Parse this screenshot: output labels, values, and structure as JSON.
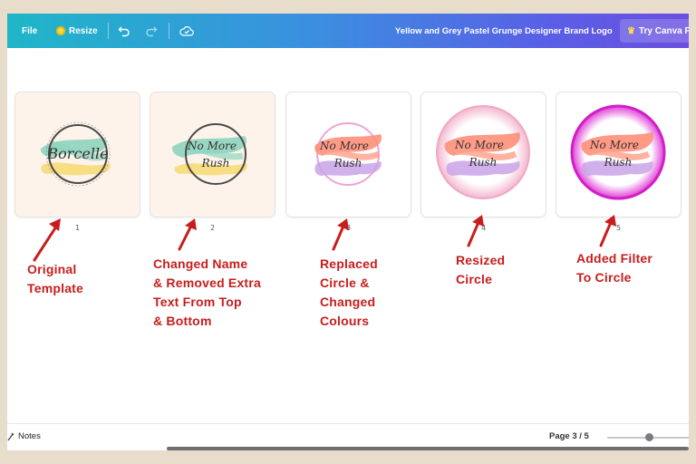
{
  "toolbar": {
    "file_label": "File",
    "resize_label": "Resize",
    "doc_title": "Yellow and Grey Pastel Grunge Designer Brand Logo",
    "try_label": "Try Canva Pr"
  },
  "pages": [
    {
      "number": "1",
      "caption": [
        "Original",
        "Template"
      ],
      "logo_text": "Borcelle"
    },
    {
      "number": "2",
      "caption": [
        "Changed Name",
        "& Removed Extra",
        "Text From Top",
        "& Bottom"
      ],
      "logo_text": [
        "No More",
        "Rush"
      ]
    },
    {
      "number": "3",
      "caption": [
        "Replaced",
        "Circle &",
        "Changed",
        "Colours"
      ],
      "logo_text": [
        "No More",
        "Rush"
      ]
    },
    {
      "number": "4",
      "caption": [
        "Resized",
        "Circle"
      ],
      "logo_text": [
        "No More",
        "Rush"
      ]
    },
    {
      "number": "5",
      "caption": [
        "Added Filter",
        "To Circle"
      ],
      "logo_text": [
        "No More",
        "Rush"
      ]
    }
  ],
  "footer": {
    "notes_label": "Notes",
    "page_indicator": "Page 3 / 5"
  },
  "colors": {
    "annotation": "#c81d1d",
    "background": "#e8dccb"
  }
}
